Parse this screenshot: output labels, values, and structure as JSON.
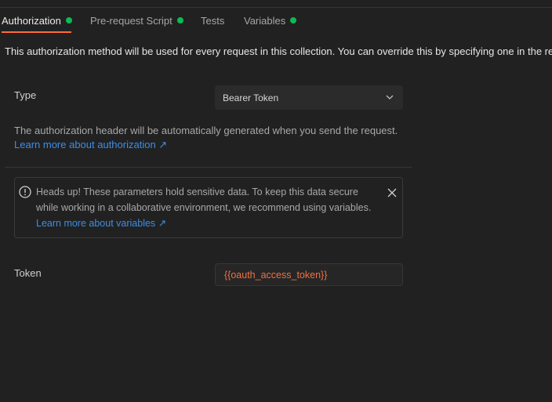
{
  "tabs": [
    {
      "label": "Authorization",
      "has_indicator": true,
      "active": true
    },
    {
      "label": "Pre-request Script",
      "has_indicator": true,
      "active": false
    },
    {
      "label": "Tests",
      "has_indicator": false,
      "active": false
    },
    {
      "label": "Variables",
      "has_indicator": true,
      "active": false
    }
  ],
  "info_text": "This authorization method will be used for every request in this collection. You can override this by specifying one in the request.",
  "type": {
    "label": "Type",
    "selected": "Bearer Token",
    "icon": "chevron-down-icon"
  },
  "help": {
    "text": "The authorization header will be automatically generated when you send the request.",
    "link": "Learn more about authorization ↗"
  },
  "alert": {
    "icon": "alert-circle-icon",
    "text": "Heads up! These parameters hold sensitive data. To keep this data secure while working in a collaborative environment, we recommend using variables.",
    "link": "Learn more about variables ↗",
    "close_icon": "close-icon"
  },
  "token": {
    "label": "Token",
    "value": "{{oauth_access_token}}"
  },
  "colors": {
    "background": "#212121",
    "accent": "#ff6c37",
    "indicator": "#0cbb52",
    "link": "#3d8ee6",
    "variable": "#f07142"
  }
}
